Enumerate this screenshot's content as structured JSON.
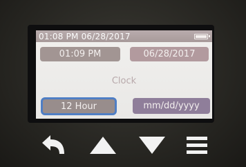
{
  "status_bar": {
    "datetime": "01:08 PM 06/28/2017",
    "battery_icon": "battery-full-icon"
  },
  "time_field": {
    "value": "01:09 PM"
  },
  "date_field": {
    "value": "06/28/2017"
  },
  "section": {
    "label": "Clock"
  },
  "hour_format": {
    "value": "12 Hour"
  },
  "date_format": {
    "value": "mm/dd/yyyy"
  },
  "nav_buttons": {
    "back": "back-arrow-icon",
    "up": "up-triangle-icon",
    "down": "down-triangle-icon",
    "menu": "menu-icon"
  },
  "colors": {
    "status_bar": "#a89a9a",
    "time_pill": "#a29593",
    "date_pill": "#b29a9e",
    "selected_border": "#4f7ec4",
    "format_pill": "#8f7e9a"
  }
}
